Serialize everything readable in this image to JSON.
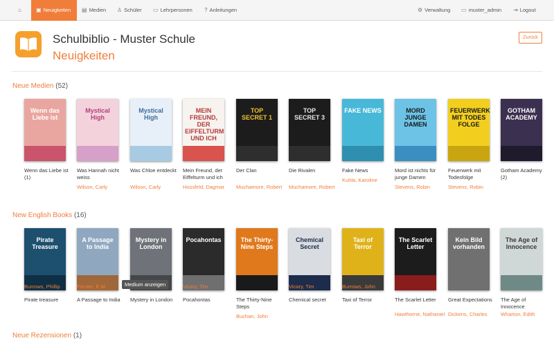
{
  "nav": {
    "left": [
      {
        "label": "",
        "icon": "home-icon",
        "glyph": "⌂"
      },
      {
        "label": "Neuigkeiten",
        "icon": "newspaper-icon",
        "glyph": "▣"
      },
      {
        "label": "Medien",
        "icon": "book-icon",
        "glyph": "▤"
      },
      {
        "label": "Schüler",
        "icon": "user-icon",
        "glyph": "♙"
      },
      {
        "label": "Lehrpersonen",
        "icon": "id-card-icon",
        "glyph": "▭"
      },
      {
        "label": "Anleitungen",
        "icon": "help-icon",
        "glyph": "?"
      }
    ],
    "right": [
      {
        "label": "Verwaltung",
        "icon": "gear-icon",
        "glyph": "⚙"
      },
      {
        "label": "muster_admin",
        "icon": "monitor-icon",
        "glyph": "▭"
      },
      {
        "label": "Logout",
        "icon": "logout-icon",
        "glyph": "⇥"
      }
    ]
  },
  "header": {
    "school": "Schulbiblio - Muster Schule",
    "title": "Neuigkeiten",
    "back": "Zurück"
  },
  "sections": [
    {
      "name": "Neue Medien",
      "count": "(52)",
      "books": [
        {
          "title": "Wenn das Liebe ist (1)",
          "author": "",
          "cover": {
            "bg": "#e9a6a0",
            "band": "#c9546b",
            "text": "Wenn das Liebe ist",
            "tc": "#ffffff"
          }
        },
        {
          "title": "Was Hannah nicht weiss",
          "author": "Wilson, Carly",
          "cover": {
            "bg": "#f4d2dc",
            "band": "#d6a0c8",
            "text": "Mystical High",
            "tc": "#b0407a"
          }
        },
        {
          "title": "Was Chloe entdeckt",
          "author": "Wilson, Carly",
          "cover": {
            "bg": "#e7f0f8",
            "band": "#a6cbe3",
            "text": "Mystical High",
            "tc": "#406a9a"
          }
        },
        {
          "title": "Mein Freund, der Eiffelturm und ich",
          "author": "Hossfeld, Dagmar",
          "cover": {
            "bg": "#f7f3ef",
            "band": "#d9534f",
            "text": "MEIN FREUND, DER EIFFELTURM UND ICH",
            "tc": "#b33a3a"
          }
        },
        {
          "title": "Der Clan",
          "author": "Muchamore, Robert",
          "cover": {
            "bg": "#1c1c1c",
            "band": "#2e2e2e",
            "text": "TOP SECRET 1",
            "tc": "#f0c330"
          }
        },
        {
          "title": "Die Rivalen",
          "author": "Muchamore, Robert",
          "cover": {
            "bg": "#1c1c1c",
            "band": "#2e2e2e",
            "text": "TOP SECRET 3",
            "tc": "#e8e8e8"
          }
        },
        {
          "title": "Fake News",
          "author": "Kuhla, Karoline",
          "cover": {
            "bg": "#48b8d8",
            "band": "#2f8fb0",
            "text": "FAKE NEWS",
            "tc": "#ffffff"
          }
        },
        {
          "title": "Mord ist nichts für junge Damen",
          "author": "Stevens, Robin",
          "cover": {
            "bg": "#6cc3e6",
            "band": "#3a8fc0",
            "text": "MORD JUNGE DAMEN",
            "tc": "#1a1a1a"
          }
        },
        {
          "title": "Feuerwerk mit Todesfolge",
          "author": "Stevens, Robin",
          "cover": {
            "bg": "#f2cf1f",
            "band": "#c9a60f",
            "text": "FEUERWERK MIT TODES FOLGE",
            "tc": "#1a1a1a"
          }
        },
        {
          "title": "Gotham Academy (2)",
          "author": "",
          "cover": {
            "bg": "#3b3050",
            "band": "#1f1a2c",
            "text": "GOTHAM ACADEMY",
            "tc": "#ffffff"
          }
        }
      ]
    },
    {
      "name": "New English Books",
      "count": "(16)",
      "books": [
        {
          "title": "Pirate treasure",
          "author": "Burrows, Phillip",
          "cover": {
            "bg": "#1d4f6e",
            "band": "#0f2f44",
            "text": "Pirate Treasure",
            "tc": "#ffffff"
          }
        },
        {
          "title": "A Passage to India",
          "author": "Forster, E.M.",
          "cover": {
            "bg": "#8fa8c0",
            "band": "#a0673a",
            "text": "A Passage to India",
            "tc": "#ffffff"
          }
        },
        {
          "title": "Mystery in London",
          "author": "Brooke, Helen",
          "cover": {
            "bg": "#6f7278",
            "band": "#44464a",
            "text": "Mystery in London",
            "tc": "#ffffff"
          }
        },
        {
          "title": "Pocahontas",
          "author": "Vicary, Tim",
          "cover": {
            "bg": "#2b2b2b",
            "band": "#6f6f6f",
            "text": "Pocahontas",
            "tc": "#ffffff"
          }
        },
        {
          "title": "The Thirty-Nine Steps",
          "author": "Buchan, John",
          "cover": {
            "bg": "#e0781c",
            "band": "#1a1a1a",
            "text": "The Thirty-Nine Steps",
            "tc": "#ffffff"
          }
        },
        {
          "title": "Chemical secret",
          "author": "Vicary, Tim",
          "cover": {
            "bg": "#d9dde2",
            "band": "#1c2c4a",
            "text": "Chemical Secret",
            "tc": "#1c2c4a"
          }
        },
        {
          "title": "Taxi of Terror",
          "author": "Burrows, John",
          "cover": {
            "bg": "#e0b21a",
            "band": "#3a3a3a",
            "text": "Taxi of Terror",
            "tc": "#ffffff"
          }
        },
        {
          "title": "The Scarlet Letter",
          "author": "Hawthorne, Nathaniel",
          "cover": {
            "bg": "#1c1c1c",
            "band": "#8a1c1c",
            "text": "The Scarlet Letter",
            "tc": "#ffffff"
          }
        },
        {
          "title": "Great Expectations",
          "author": "Dickens, Charles",
          "cover": {
            "bg": "#707070",
            "band": "#707070",
            "text": "Kein Bild vorhanden",
            "tc": "#ffffff"
          }
        },
        {
          "title": "The Age of Innocence",
          "author": "Wharton, Edith",
          "cover": {
            "bg": "#cfd8d6",
            "band": "#6f8a86",
            "text": "The Age of Innocence",
            "tc": "#3a3a3a"
          }
        }
      ]
    },
    {
      "name": "Neue Rezensionen",
      "count": "(1)",
      "books": []
    }
  ],
  "tooltip": "Medium anzeigen",
  "colors": {
    "accent": "#f07d3a",
    "logo": "#f5a02c",
    "navbar": "#f5f5f5"
  }
}
